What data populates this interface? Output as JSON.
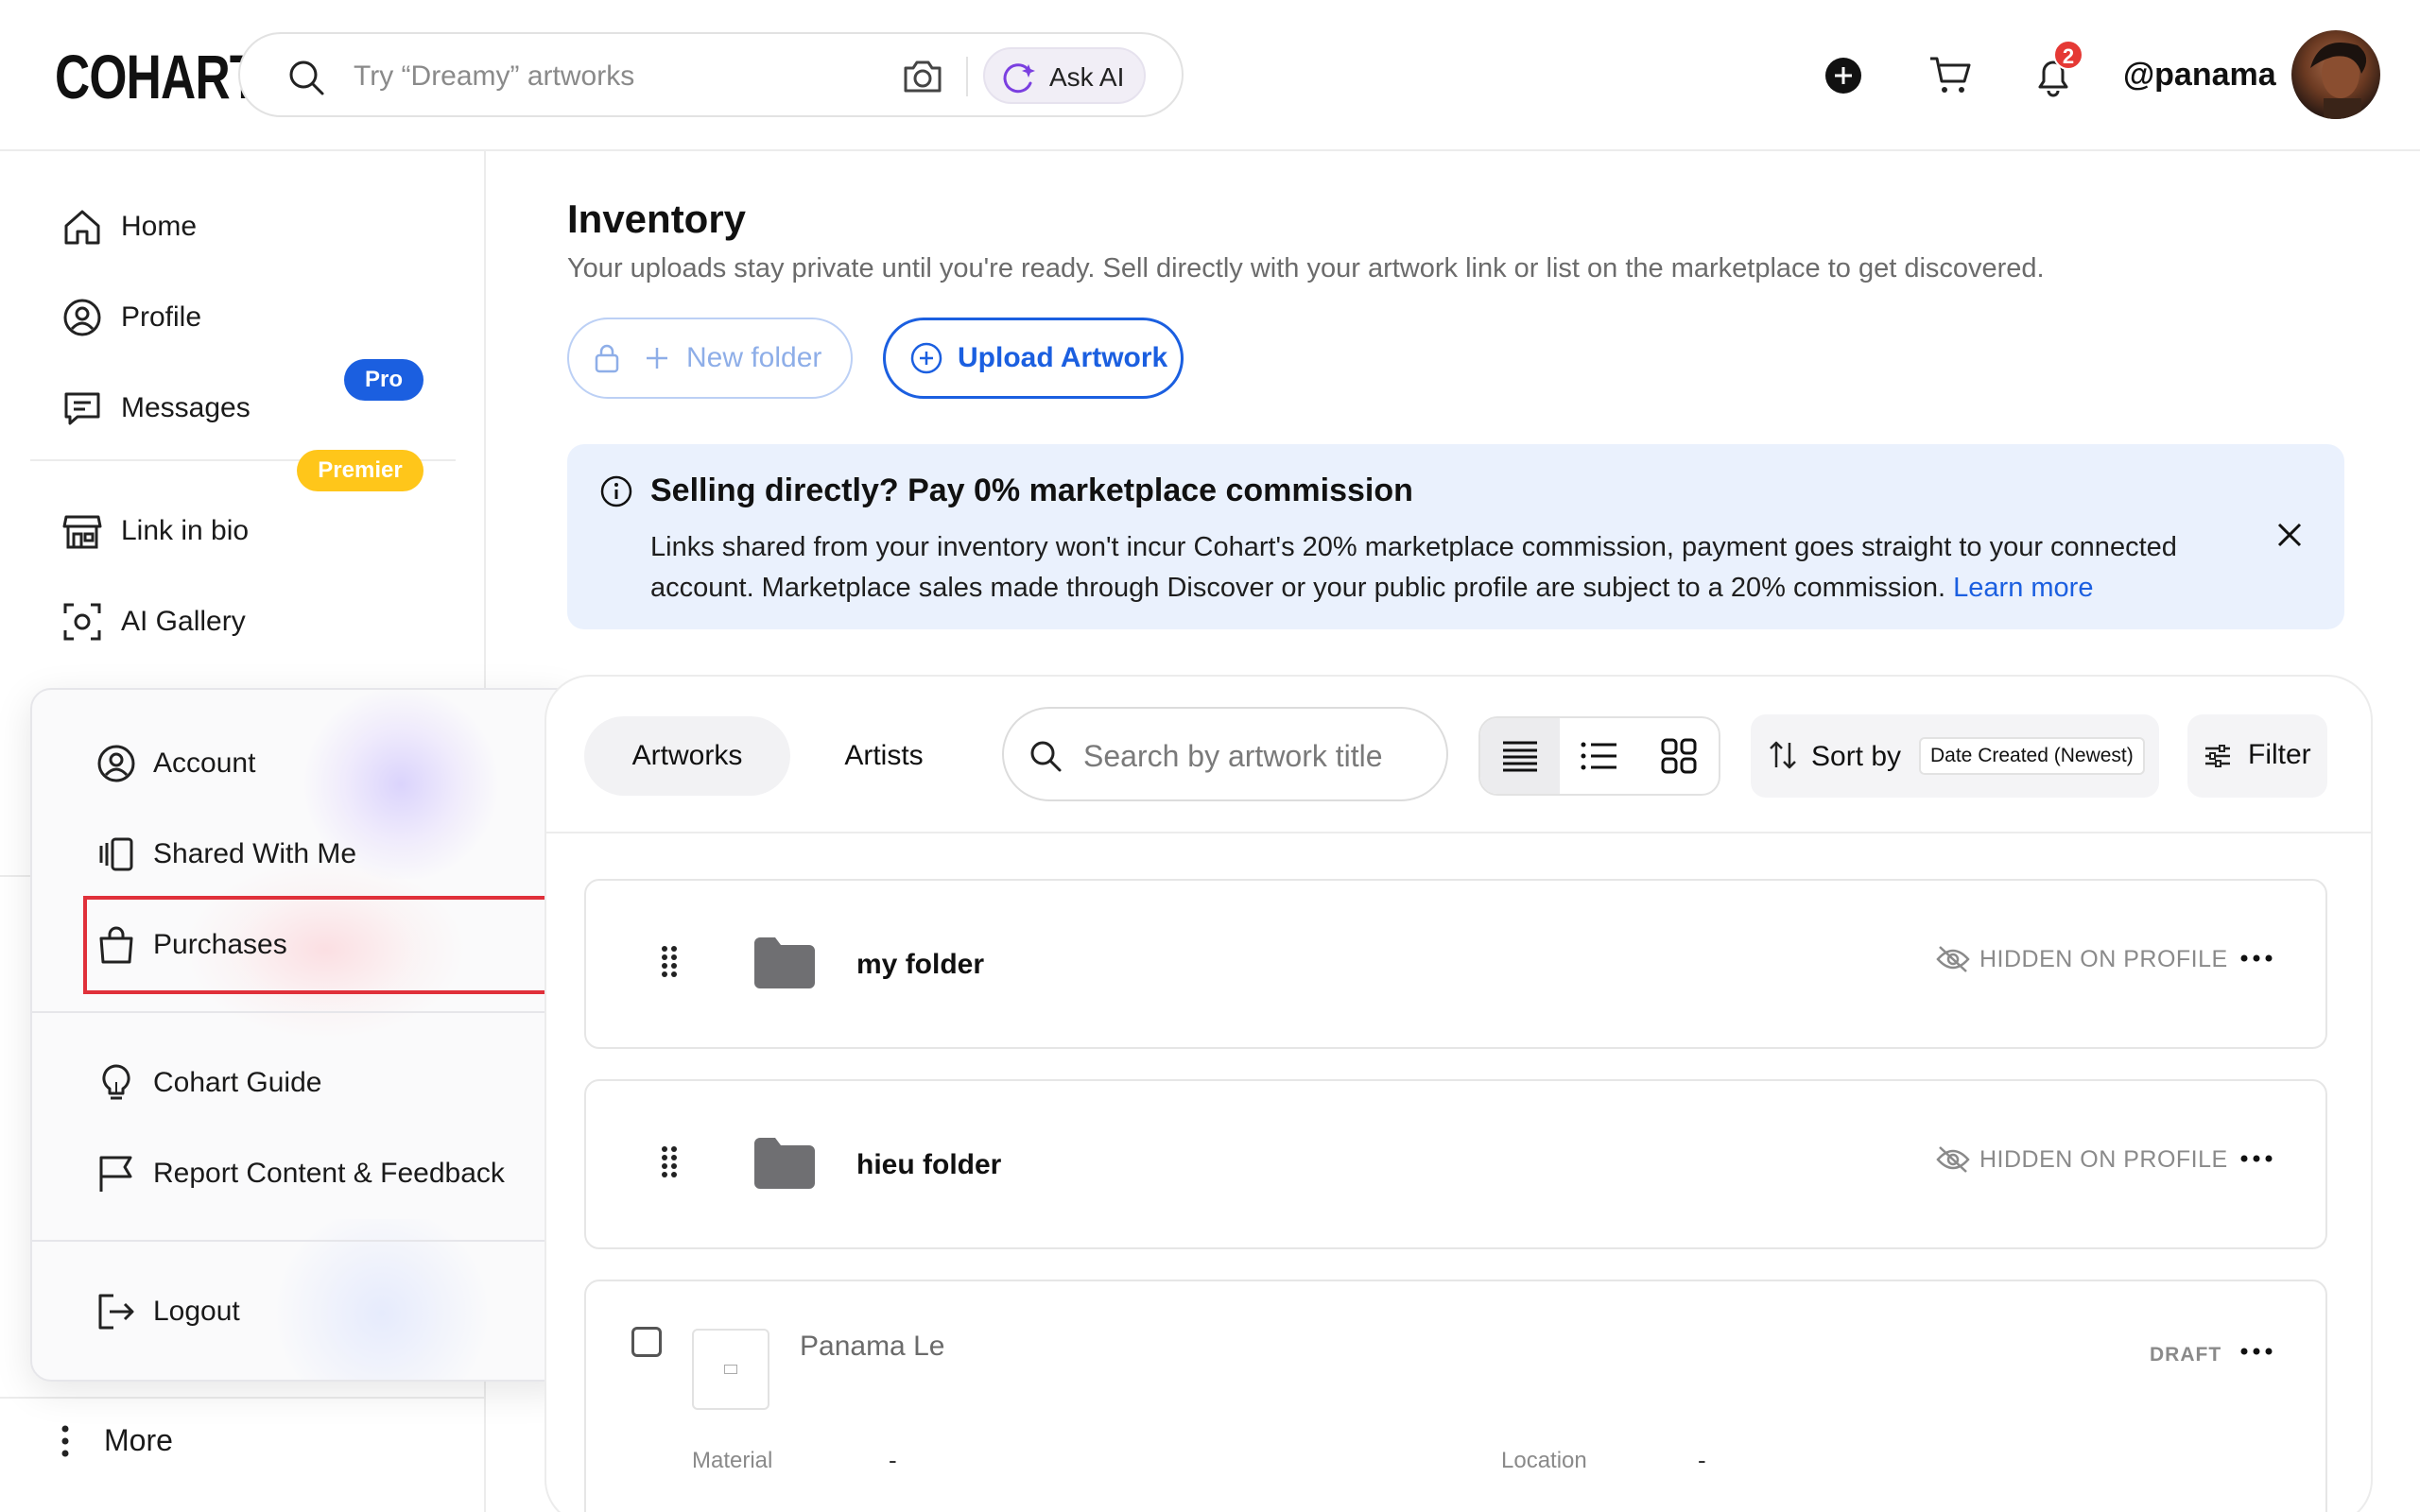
{
  "header": {
    "logo": "COHART",
    "search_placeholder": "Try “Dreamy” artworks",
    "ask_ai_label": "Ask AI",
    "notification_count": "2",
    "username": "@panama"
  },
  "sidebar": {
    "items": [
      {
        "label": "Home",
        "icon": "home-icon"
      },
      {
        "label": "Profile",
        "icon": "profile-icon"
      },
      {
        "label": "Messages",
        "icon": "message-icon"
      },
      {
        "label": "Link in bio",
        "icon": "storefront-icon",
        "badge": "Pro"
      },
      {
        "label": "AI Gallery",
        "icon": "scan-face-icon",
        "badge": "Premier"
      }
    ],
    "more_label": "More"
  },
  "dropdown": {
    "items": [
      {
        "label": "Account",
        "icon": "account-icon"
      },
      {
        "label": "Shared With Me",
        "icon": "shared-icon"
      },
      {
        "label": "Purchases",
        "icon": "shopping-bag-icon"
      },
      {
        "label": "Cohart Guide",
        "icon": "lightbulb-icon"
      },
      {
        "label": "Report Content & Feedback",
        "icon": "flag-icon"
      },
      {
        "label": "Logout",
        "icon": "logout-icon"
      }
    ]
  },
  "main": {
    "title": "Inventory",
    "subtitle": "Your uploads stay private until you're ready. Sell directly with your artwork link or list on the marketplace to get discovered.",
    "new_folder_label": "New folder",
    "upload_label": "Upload Artwork",
    "banner": {
      "title": "Selling directly? Pay 0% marketplace commission",
      "body": "Links shared from your inventory won't incur Cohart's 20% marketplace commission, payment goes straight to your connected account. Marketplace sales made through Discover or your public profile are subject to a 20% commission.",
      "link": "Learn more"
    },
    "tabs": [
      {
        "label": "Artworks",
        "active": true
      },
      {
        "label": "Artists",
        "active": false
      }
    ],
    "search_placeholder": "Search by artwork title",
    "sort_label": "Sort by",
    "sort_value": "Date Created (Newest)",
    "filter_label": "Filter",
    "folders": [
      {
        "name": "my folder",
        "visibility": "HIDDEN ON PROFILE"
      },
      {
        "name": "hieu folder",
        "visibility": "HIDDEN ON PROFILE"
      }
    ],
    "artwork": {
      "artist": "Panama Le",
      "status": "DRAFT",
      "material_label": "Material",
      "material_value": "-",
      "location_label": "Location",
      "location_value": "-"
    }
  },
  "colors": {
    "accent": "#1b5fe0",
    "premier": "#ffc61a",
    "banner_bg": "#eaf1fd",
    "highlight": "#e0303a",
    "badge": "#e53935"
  }
}
